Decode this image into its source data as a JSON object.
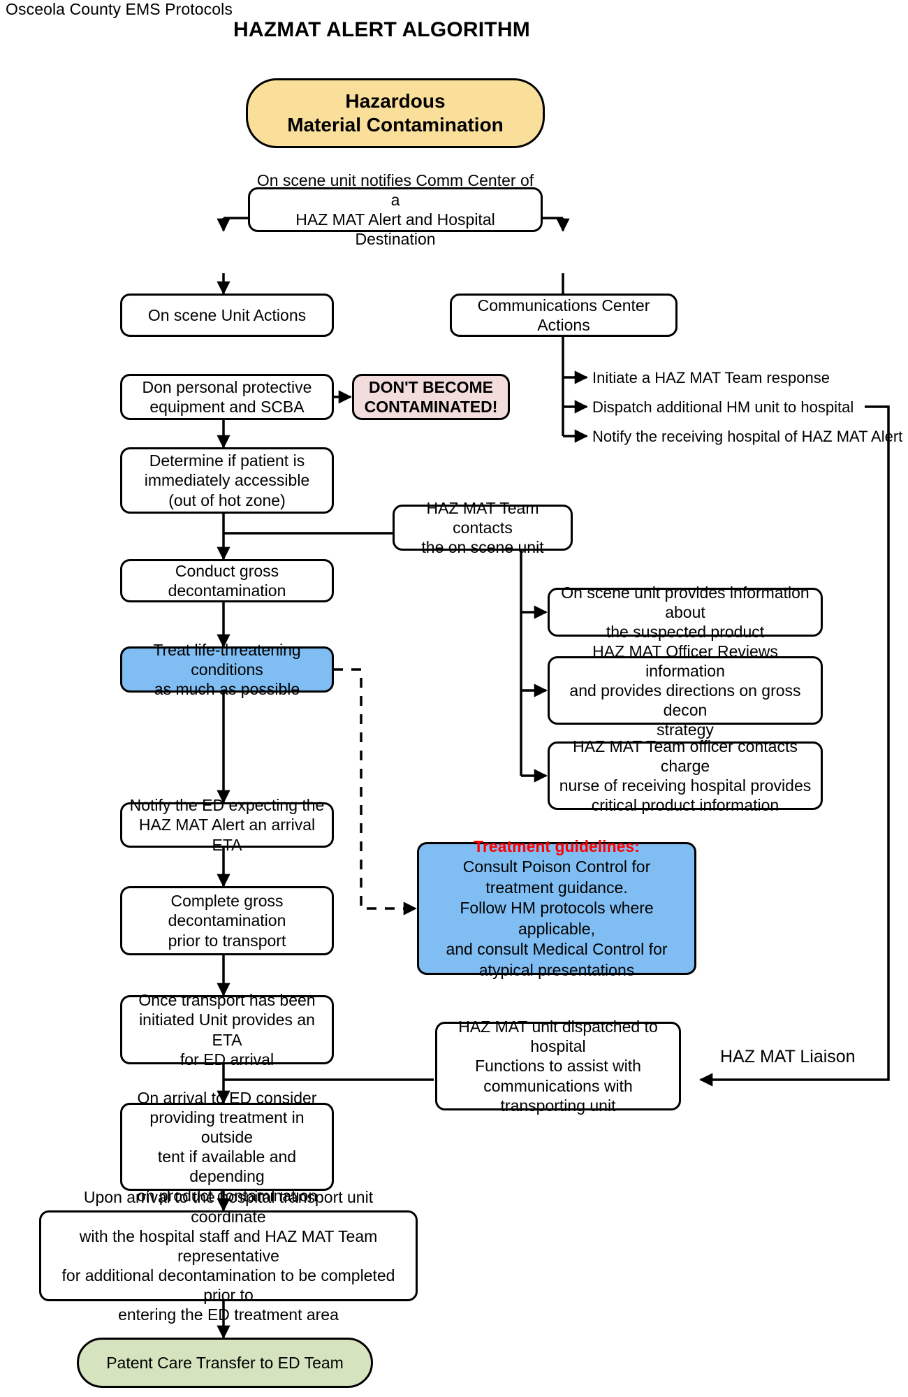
{
  "page": {
    "header": "Osceola County EMS Protocols",
    "title": "HAZMAT ALERT ALGORITHM"
  },
  "colors": {
    "start_fill": "#fadf9a",
    "warning_fill": "#f3dcdc",
    "highlight_fill": "#7fbdf2",
    "end_fill": "#d6e3bf",
    "border": "#000000",
    "treatment_title": "#ff0000"
  },
  "nodes": {
    "start": "Hazardous\nMaterial Contamination",
    "notify_comm": "On scene unit notifies Comm Center of a\nHAZ MAT Alert and Hospital Destination",
    "on_scene_actions": "On scene Unit Actions",
    "comm_center_actions": "Communications Center Actions",
    "don_ppe": "Don personal protective\nequipment and SCBA",
    "dont_become_contaminated": "DON'T BECOME\nCONTAMINATED!",
    "determine_accessible": "Determine if patient is\nimmediately accessible\n(out of hot zone)",
    "hazmat_team_contacts": "HAZ MAT Team contacts\nthe on scene unit",
    "conduct_gross_decon": "Conduct gross decontamination",
    "treat_life_threatening": "Treat life-threatening conditions\nas much as possible",
    "on_scene_provides_info": "On scene unit provides information about\nthe suspected product",
    "officer_reviews": "HAZ MAT Officer Reviews information\nand provides directions on gross decon\nstrategy",
    "officer_contacts_charge_nurse": "HAZ MAT Team officer contacts charge\nnurse of receiving hospital provides\ncritical product information",
    "notify_ed": "Notify the ED expecting the\nHAZ MAT Alert an arrival ETA",
    "complete_gross_decon": "Complete gross\ndecontamination\nprior to transport",
    "once_transport": "Once transport has been\ninitiated Unit provides an ETA\nfor ED arrival",
    "on_arrival_ed": "On arrival to ED consider\nproviding treatment in outside\ntent if available and depending\non product contamination",
    "hazmat_unit_dispatched": "HAZ MAT unit dispatched to hospital\nFunctions to assist with\ncommunications with\ntransporting unit",
    "upon_arrival_hospital": "Upon arrival to the hospital transport unit coordinate\nwith the hospital staff and HAZ MAT Team representative\nfor additional decontamination to be completed prior to\nentering the ED treatment area",
    "patient_care_transfer": "Patent Care Transfer to ED Team"
  },
  "treatment_guidelines": {
    "title": "Treatment guidelines:",
    "body": "Consult Poison Control for\ntreatment guidance.\nFollow HM protocols where applicable,\nand consult Medical Control for\natypical presentations"
  },
  "comm_bullets": [
    "Initiate a HAZ MAT Team response",
    "Dispatch additional HM unit to  hospital",
    "Notify the receiving hospital of HAZ MAT Alert"
  ],
  "free_labels": {
    "hazmat_liaison": "HAZ MAT Liaison"
  }
}
